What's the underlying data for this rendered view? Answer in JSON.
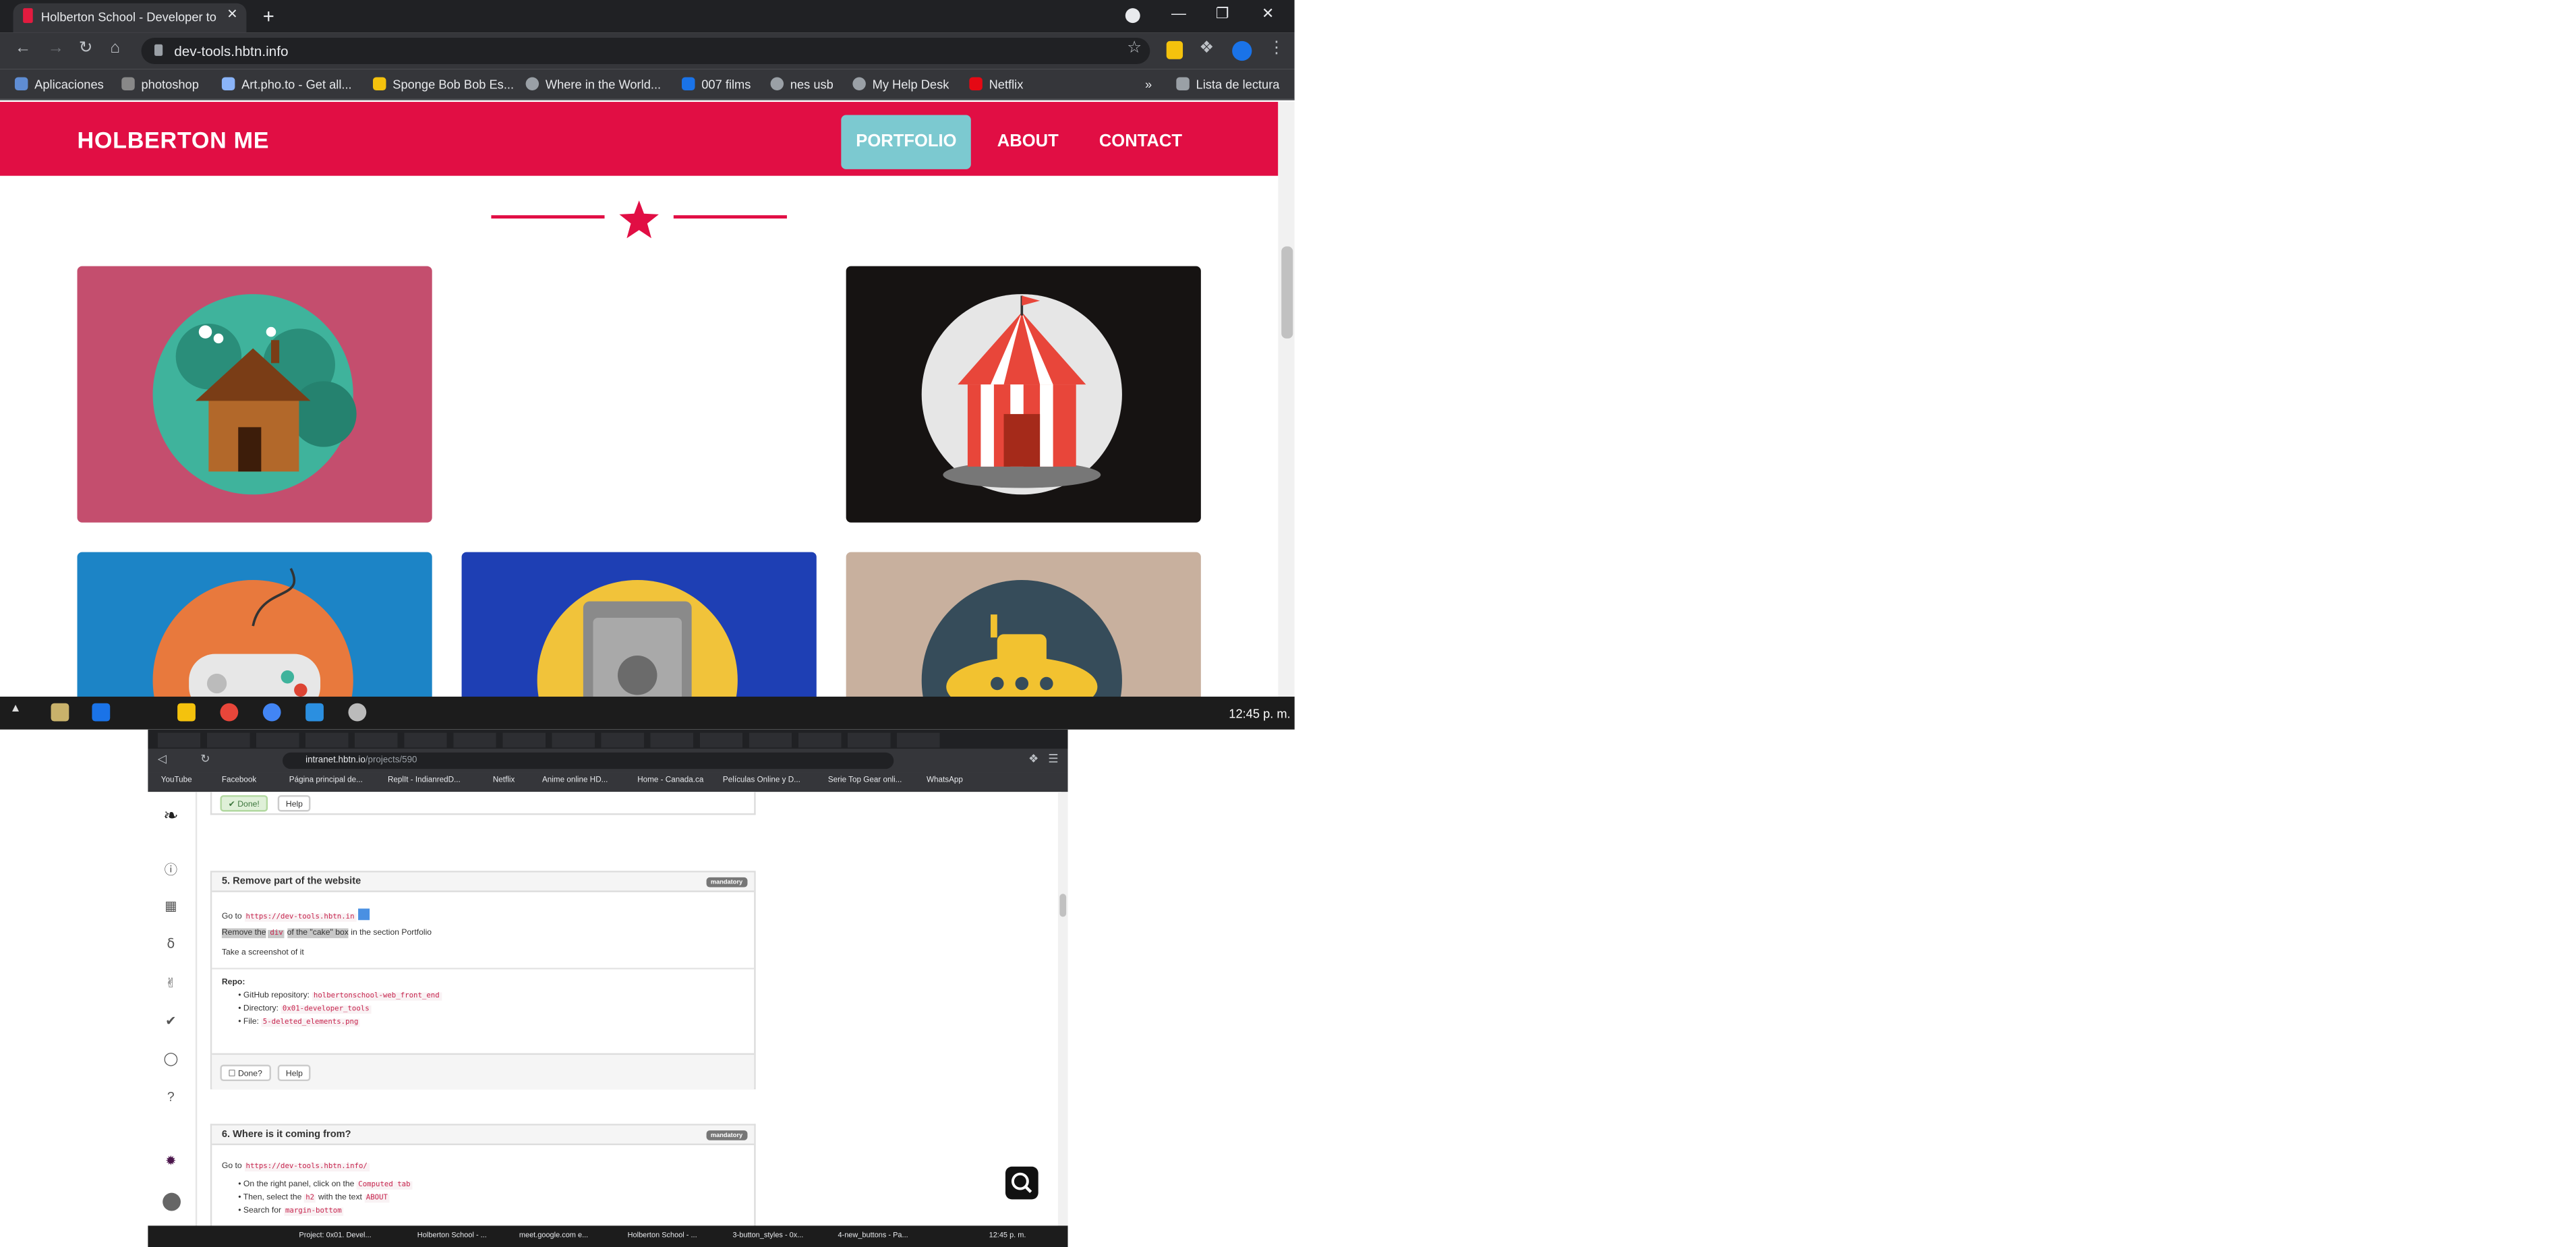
{
  "browser_top": {
    "tab_title": "Holberton School - Developer to",
    "url": "dev-tools.hbtn.info",
    "bookmarks": [
      {
        "label": "Aplicaciones",
        "color": "#5f8dd3"
      },
      {
        "label": "photoshop",
        "color": "#888888"
      },
      {
        "label": "Art.pho.to - Get all...",
        "color": "#8ab4f8"
      },
      {
        "label": "Sponge Bob Bob Es...",
        "color": "#f4c20d"
      },
      {
        "label": "Where in the World...",
        "color": "#9aa0a6"
      },
      {
        "label": "007 films",
        "color": "#1a73e8"
      },
      {
        "label": "nes usb",
        "color": "#9aa0a6"
      },
      {
        "label": "My Help Desk",
        "color": "#9aa0a6"
      },
      {
        "label": "Netflix",
        "color": "#e50914"
      }
    ],
    "bookmarks_more": "»",
    "reading_list": "Lista de lectura",
    "new_tab": "+",
    "tab_close": "✕"
  },
  "site": {
    "logo": "HOLBERTON ME",
    "nav": [
      "PORTFOLIO",
      "ABOUT",
      "CONTACT"
    ],
    "brand_color": "#e10e44",
    "active_color": "#7cc9d0",
    "portfolio": [
      {
        "name": "cabin",
        "bg": "#c44e6e"
      },
      {
        "name": "circus-tent",
        "bg": "#161312"
      },
      {
        "name": "game-controller",
        "bg": "#1c84c6"
      },
      {
        "name": "safe",
        "bg": "#1e3fb4"
      },
      {
        "name": "submarine",
        "bg": "#c8b09e"
      }
    ]
  },
  "taskbar_top": {
    "time": "12:45 p. m."
  },
  "inner_browser": {
    "url_host": "intranet.hbtn.io",
    "url_path": "/projects/590",
    "bookmarks": [
      "YouTube",
      "Facebook",
      "Página principal de...",
      "ReplIt - IndianredD...",
      "Netflix",
      "Anime online HD...",
      "Home - Canada.ca",
      "Películas Online y D...",
      "Serie Top Gear onli...",
      "WhatsApp"
    ],
    "task5": {
      "title": "5. Remove part of the website",
      "badge": "mandatory",
      "goto": "Go to",
      "link": "https://dev-tools.hbtn.in",
      "remove_a": "Remove the",
      "remove_code": "div",
      "remove_b": "of the \"cake\" box",
      "remove_c": " in the section Portfolio",
      "screenshot": "Take a screenshot of it",
      "repo_label": "Repo:",
      "repo_items": [
        {
          "label": "GitHub repository:",
          "code": "holbertonschool-web_front_end"
        },
        {
          "label": "Directory:",
          "code": "0x01-developer_tools"
        },
        {
          "label": "File:",
          "code": "5-deleted_elements.png"
        }
      ],
      "done": "Done?",
      "help": "Help"
    },
    "prev_done": "Done!",
    "prev_help": "Help",
    "task6": {
      "title": "6. Where is it coming from?",
      "badge": "mandatory",
      "goto": "Go to",
      "link": "https://dev-tools.hbtn.info/",
      "items": [
        {
          "text": "On the right panel, click on the",
          "code": "Computed tab"
        },
        {
          "text": "Then, select the",
          "code": "h2",
          "text2": "with the text",
          "code2": "ABOUT"
        },
        {
          "text": "Search for",
          "code": "margin-bottom"
        }
      ]
    },
    "taskbar": [
      "Project: 0x01. Devel...",
      "Holberton School - ...",
      "meet.google.com e...",
      "Holberton School - ...",
      "3-button_styles - 0x...",
      "4-new_buttons - Pa..."
    ],
    "time": "12:45 p. m."
  }
}
